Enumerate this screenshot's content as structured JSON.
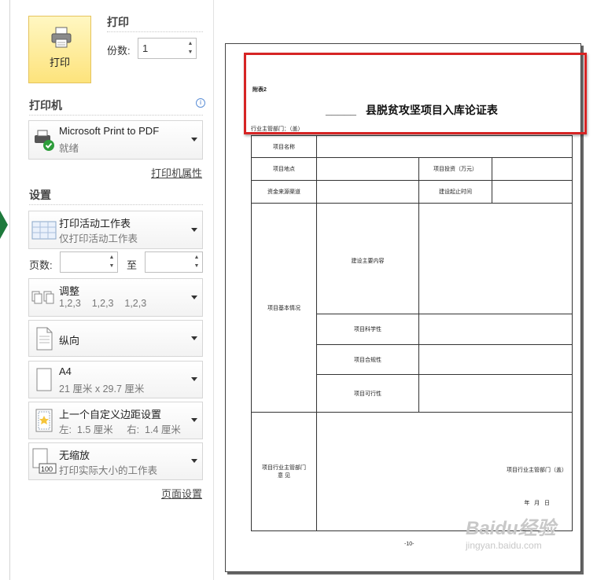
{
  "print": {
    "header": "打印",
    "button_label": "打印",
    "copies_label": "份数:",
    "copies_value": "1"
  },
  "printer": {
    "header": "打印机",
    "name": "Microsoft Print to PDF",
    "status": "就绪",
    "properties_link": "打印机属性"
  },
  "settings": {
    "header": "设置",
    "scope": {
      "title": "打印活动工作表",
      "subtitle": "仅打印活动工作表"
    },
    "pages": {
      "label": "页数:",
      "to_label": "至",
      "from_value": "",
      "to_value": ""
    },
    "collate": {
      "title": "调整",
      "subtitle": "1,2,3    1,2,3    1,2,3"
    },
    "orientation": {
      "title": "纵向"
    },
    "paper": {
      "title": "A4",
      "subtitle": "21 厘米 x 29.7 厘米"
    },
    "margins": {
      "title": "上一个自定义边距设置",
      "subtitle": "左:  1.5 厘米     右:  1.4 厘米"
    },
    "scaling": {
      "title": "无缩放",
      "subtitle": "打印实际大小的工作表"
    },
    "page_setup_link": "页面设置"
  },
  "preview": {
    "attachment": "附表2",
    "title_blank": "_____",
    "title": "县脱贫攻坚项目入库论证表",
    "dept_line": "行业主管部门：（盖）",
    "rows": {
      "project_name": "项目名称",
      "project_location": "项目地点",
      "investment": "项目投资（万元）",
      "fund_source": "资金来源渠道",
      "construction_period": "建设起止时间",
      "basic_info": "项目基本情况",
      "main_content": "建设主要内容",
      "scientific": "项目科学性",
      "compliance": "项目合规性",
      "feasibility": "项目可行性",
      "dept_opinion_1": "项目行业主管部门",
      "dept_opinion_2": "意 见",
      "seal_text": "项目行业主管部门（盖）",
      "date_text": "年   月   日"
    },
    "page_number": "-10-",
    "watermark_1": "Baidu经验",
    "watermark_2": "jingyan.baidu.com"
  },
  "colors": {
    "highlight": "#d62424",
    "print_button": "#fde37c",
    "accent_green": "#1e7a3c"
  }
}
